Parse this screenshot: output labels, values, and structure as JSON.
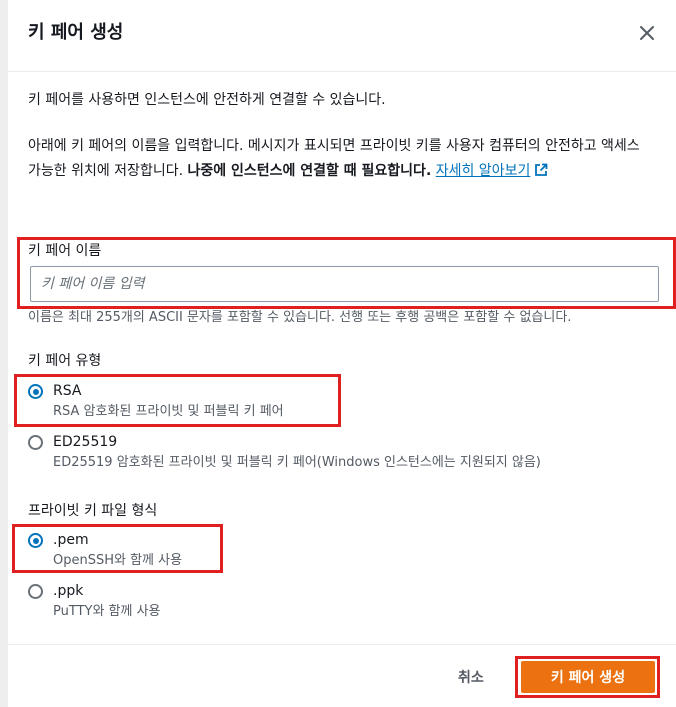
{
  "modal": {
    "title": "키 페어 생성",
    "intro": "키 페어를 사용하면 인스턴스에 안전하게 연결할 수 있습니다.",
    "desc_prefix": "아래에 키 페어의 이름을 입력합니다. 메시지가 표시되면 프라이빗 키를 사용자 컴퓨터의 안전하고 액세스 가능한 위치에 저장합니다. ",
    "desc_bold": "나중에 인스턴스에 연결할 때 필요합니다.",
    "learn_more": "자세히 알아보기"
  },
  "key_name": {
    "label": "키 페어 이름",
    "placeholder": "키 페어 이름 입력",
    "value": "",
    "hint": "이름은 최대 255개의 ASCII 문자를 포함할 수 있습니다. 선행 또는 후행 공백은 포함할 수 없습니다."
  },
  "key_type": {
    "label": "키 페어 유형",
    "options": [
      {
        "title": "RSA",
        "desc": "RSA 암호화된 프라이빗 및 퍼블릭 키 페어",
        "checked": true
      },
      {
        "title": "ED25519",
        "desc": "ED25519 암호화된 프라이빗 및 퍼블릭 키 페어(Windows 인스턴스에는 지원되지 않음)",
        "checked": false
      }
    ]
  },
  "file_format": {
    "label": "프라이빗 키 파일 형식",
    "options": [
      {
        "title": ".pem",
        "desc": "OpenSSH와 함께 사용",
        "checked": true
      },
      {
        "title": ".ppk",
        "desc": "PuTTY와 함께 사용",
        "checked": false
      }
    ]
  },
  "footer": {
    "cancel_label": "취소",
    "create_label": "키 페어 생성"
  },
  "colors": {
    "accent": "#ec7211",
    "link": "#0073bb",
    "highlight": "#e02020"
  },
  "icons": {
    "close": "close-icon",
    "external_link": "external-link-icon"
  }
}
